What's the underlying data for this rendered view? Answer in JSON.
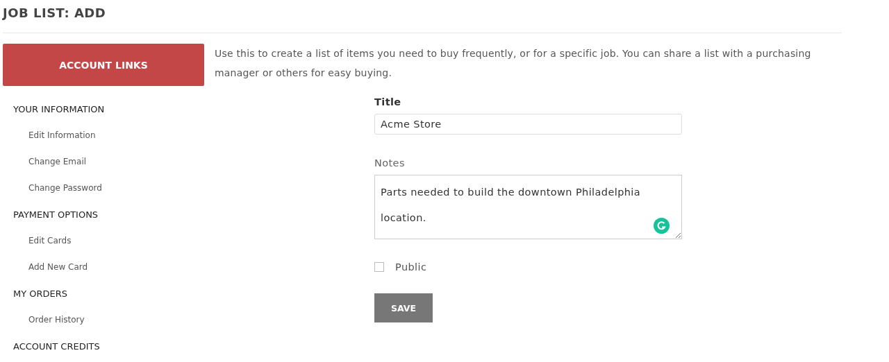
{
  "page_title": "JOB LIST: ADD",
  "sidebar": {
    "header": "ACCOUNT LINKS",
    "sections": [
      {
        "label": "YOUR INFORMATION",
        "children": [
          {
            "label": "Edit Information"
          },
          {
            "label": "Change Email"
          },
          {
            "label": "Change Password"
          }
        ]
      },
      {
        "label": "PAYMENT OPTIONS",
        "children": [
          {
            "label": "Edit Cards"
          },
          {
            "label": "Add New Card"
          }
        ]
      },
      {
        "label": "MY ORDERS",
        "children": [
          {
            "label": "Order History"
          }
        ]
      },
      {
        "label": "ACCOUNT CREDITS"
      }
    ]
  },
  "intro": "Use this to create a list of items you need to buy frequently, or for a specific job. You can share a list with a purchasing manager or others for easy buying.",
  "form": {
    "title_label": "Title",
    "title_value": "Acme Store",
    "notes_label": "Notes",
    "notes_value": "Parts needed to build the downtown Philadelphia location.",
    "public": {
      "label": "Public",
      "checked": false
    },
    "save": "SAVE"
  }
}
